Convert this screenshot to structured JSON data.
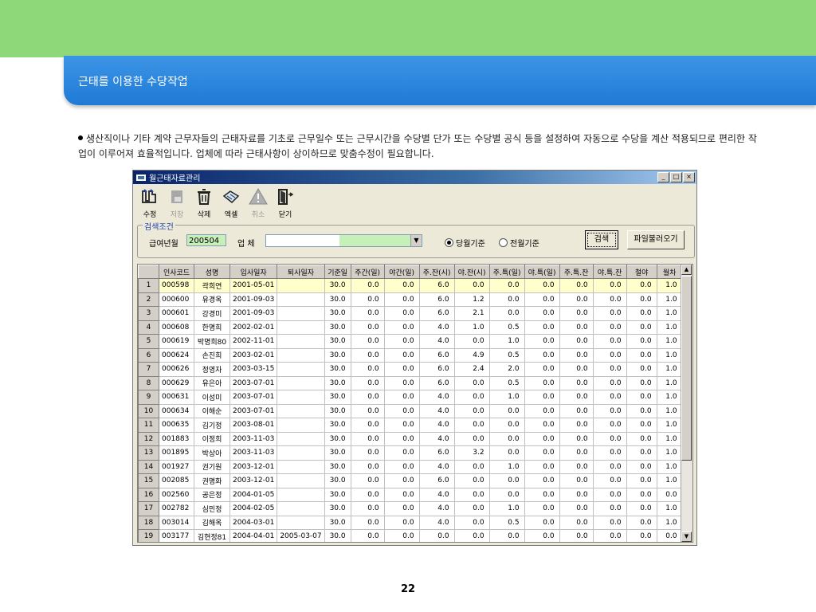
{
  "slide": {
    "title": "근태를 이용한 수당작업",
    "description": "생산직이나 기타 계약 근무자들의 근태자료를 기초로 근무일수 또는 근무시간을 수당별 단가 또는 수당별 공식 등을 설정하여 자동으로 수당을  계산 적용되므로 편리한 작업이 이루어져 효율적입니다. 업체에 따라 근태사항이 상이하므로 맞춤수정이 필요합니다.",
    "page_number": "22",
    "colors": {
      "header_green": "#8fd87a",
      "title_blue": "#2b86de"
    }
  },
  "window": {
    "title": "월근태자료관리",
    "controls": [
      "_",
      "□",
      "×"
    ],
    "toolbar": [
      {
        "label": "수정",
        "icon": "edit-icon",
        "enabled": true
      },
      {
        "label": "저장",
        "icon": "save-icon",
        "enabled": false
      },
      {
        "label": "삭제",
        "icon": "delete-icon",
        "enabled": true
      },
      {
        "label": "엑셀",
        "icon": "excel-icon",
        "enabled": true
      },
      {
        "label": "취소",
        "icon": "cancel-icon",
        "enabled": false
      },
      {
        "label": "닫기",
        "icon": "exit-icon",
        "enabled": true
      }
    ],
    "search": {
      "legend": "검색조건",
      "pay_month_label": "급여년월",
      "pay_month_value": "200504",
      "company_label": "업 체",
      "company_value": "",
      "radio_current": "당월기준",
      "radio_prev": "전월기준",
      "radio_selected": "당월기준",
      "search_button": "검색",
      "import_button": "파일불러오기"
    },
    "grid": {
      "columns": [
        "",
        "인사코드",
        "성명",
        "입사일자",
        "퇴사일자",
        "기준일",
        "주간(일)",
        "야간(일)",
        "주.잔(시)",
        "야.잔(시)",
        "주.특(일)",
        "야.특(일)",
        "주.특.잔",
        "야.특.잔",
        "철야",
        "월차"
      ],
      "rows": [
        [
          "1",
          "000598",
          "곽희연",
          "2001-05-01",
          "",
          "30.0",
          "0.0",
          "0.0",
          "6.0",
          "0.0",
          "0.0",
          "0.0",
          "0.0",
          "0.0",
          "0.0",
          "1.0"
        ],
        [
          "2",
          "000600",
          "유경옥",
          "2001-09-03",
          "",
          "30.0",
          "0.0",
          "0.0",
          "6.0",
          "1.2",
          "0.0",
          "0.0",
          "0.0",
          "0.0",
          "0.0",
          "1.0"
        ],
        [
          "3",
          "000601",
          "강경미",
          "2001-09-03",
          "",
          "30.0",
          "0.0",
          "0.0",
          "6.0",
          "2.1",
          "0.0",
          "0.0",
          "0.0",
          "0.0",
          "0.0",
          "1.0"
        ],
        [
          "4",
          "000608",
          "한명희",
          "2002-02-01",
          "",
          "30.0",
          "0.0",
          "0.0",
          "4.0",
          "1.0",
          "0.5",
          "0.0",
          "0.0",
          "0.0",
          "0.0",
          "1.0"
        ],
        [
          "5",
          "000619",
          "박명희80",
          "2002-11-01",
          "",
          "30.0",
          "0.0",
          "0.0",
          "4.0",
          "0.0",
          "1.0",
          "0.0",
          "0.0",
          "0.0",
          "0.0",
          "1.0"
        ],
        [
          "6",
          "000624",
          "손진희",
          "2003-02-01",
          "",
          "30.0",
          "0.0",
          "0.0",
          "6.0",
          "4.9",
          "0.5",
          "0.0",
          "0.0",
          "0.0",
          "0.0",
          "1.0"
        ],
        [
          "7",
          "000626",
          "정영자",
          "2003-03-15",
          "",
          "30.0",
          "0.0",
          "0.0",
          "6.0",
          "2.4",
          "2.0",
          "0.0",
          "0.0",
          "0.0",
          "0.0",
          "1.0"
        ],
        [
          "8",
          "000629",
          "유은아",
          "2003-07-01",
          "",
          "30.0",
          "0.0",
          "0.0",
          "6.0",
          "0.0",
          "0.5",
          "0.0",
          "0.0",
          "0.0",
          "0.0",
          "1.0"
        ],
        [
          "9",
          "000631",
          "이성미",
          "2003-07-01",
          "",
          "30.0",
          "0.0",
          "0.0",
          "4.0",
          "0.0",
          "1.0",
          "0.0",
          "0.0",
          "0.0",
          "0.0",
          "1.0"
        ],
        [
          "10",
          "000634",
          "이해순",
          "2003-07-01",
          "",
          "30.0",
          "0.0",
          "0.0",
          "4.0",
          "0.0",
          "0.0",
          "0.0",
          "0.0",
          "0.0",
          "0.0",
          "1.0"
        ],
        [
          "11",
          "000635",
          "김기정",
          "2003-08-01",
          "",
          "30.0",
          "0.0",
          "0.0",
          "4.0",
          "0.0",
          "0.0",
          "0.0",
          "0.0",
          "0.0",
          "0.0",
          "1.0"
        ],
        [
          "12",
          "001883",
          "이정희",
          "2003-11-03",
          "",
          "30.0",
          "0.0",
          "0.0",
          "4.0",
          "0.0",
          "0.0",
          "0.0",
          "0.0",
          "0.0",
          "0.0",
          "1.0"
        ],
        [
          "13",
          "001895",
          "박상아",
          "2003-11-03",
          "",
          "30.0",
          "0.0",
          "0.0",
          "6.0",
          "3.2",
          "0.0",
          "0.0",
          "0.0",
          "0.0",
          "0.0",
          "1.0"
        ],
        [
          "14",
          "001927",
          "권기원",
          "2003-12-01",
          "",
          "30.0",
          "0.0",
          "0.0",
          "4.0",
          "0.0",
          "1.0",
          "0.0",
          "0.0",
          "0.0",
          "0.0",
          "1.0"
        ],
        [
          "15",
          "002085",
          "권명화",
          "2003-12-01",
          "",
          "30.0",
          "0.0",
          "0.0",
          "6.0",
          "0.0",
          "0.0",
          "0.0",
          "0.0",
          "0.0",
          "0.0",
          "1.0"
        ],
        [
          "16",
          "002560",
          "공은정",
          "2004-01-05",
          "",
          "30.0",
          "0.0",
          "0.0",
          "4.0",
          "0.0",
          "0.0",
          "0.0",
          "0.0",
          "0.0",
          "0.0",
          "0.0"
        ],
        [
          "17",
          "002782",
          "심민정",
          "2004-02-05",
          "",
          "30.0",
          "0.0",
          "0.0",
          "4.0",
          "0.0",
          "1.0",
          "0.0",
          "0.0",
          "0.0",
          "0.0",
          "1.0"
        ],
        [
          "18",
          "003014",
          "김해옥",
          "2004-03-01",
          "",
          "30.0",
          "0.0",
          "0.0",
          "4.0",
          "0.0",
          "0.5",
          "0.0",
          "0.0",
          "0.0",
          "0.0",
          "1.0"
        ],
        [
          "19",
          "003177",
          "김현정81",
          "2004-04-01",
          "2005-03-07",
          "30.0",
          "0.0",
          "0.0",
          "0.0",
          "0.0",
          "0.0",
          "0.0",
          "0.0",
          "0.0",
          "0.0",
          "0.0"
        ]
      ],
      "selected_row": 0
    }
  }
}
